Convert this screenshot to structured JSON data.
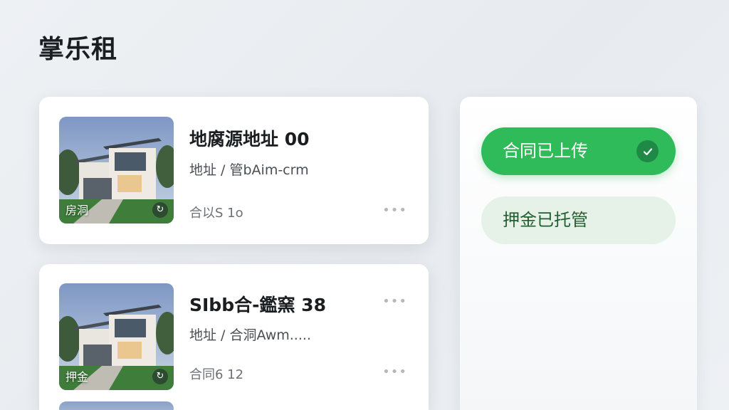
{
  "app": {
    "title": "掌乐租"
  },
  "listings": [
    {
      "title": "地腐源地址 00",
      "address": "地址 / 管bAim-crm",
      "meta": "合以S 1ο",
      "thumb_tag": "房洞"
    },
    {
      "title": "SIbb合-鑑窯 38",
      "address": "地址 / 合洞Awm.....",
      "meta": "合同6 12",
      "thumb_tag": "押金"
    }
  ],
  "status_panel": {
    "contract_pill": "合同已上传",
    "deposit_pill": "押金已托管"
  },
  "icons": {
    "more": "more-horizontal-icon",
    "check": "check-icon",
    "thumb_badge": "view-icon"
  },
  "colors": {
    "accent_green": "#2fbb5a",
    "light_green": "#e6f1e8",
    "deposit_text": "#1e5f30"
  }
}
